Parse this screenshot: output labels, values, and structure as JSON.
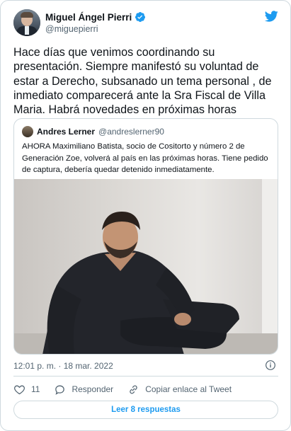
{
  "author": {
    "name": "Miguel Ángel Pierri",
    "handle": "@miguepierri",
    "verified": true
  },
  "tweet": {
    "text": "Hace días que venimos coordinando su presentación. Siempre manifestó su voluntad de estar a Derecho, subsanado un tema personal , de inmediato comparecerá ante la Sra Fiscal de Villa Maria. Habrá novedades en próximas horas"
  },
  "quoted": {
    "name": "Andres Lerner",
    "handle": "@andreslerner90",
    "text": "AHORA Maximiliano Batista, socio de Cositorto y número 2 de Generación Zoe, volverá al país en las próximas horas. Tiene pedido de captura, debería quedar detenido inmediatamente."
  },
  "meta": {
    "timestamp": "12:01 p. m. · 18 mar. 2022"
  },
  "actions": {
    "like_count": "11",
    "reply_label": "Responder",
    "copy_link_label": "Copiar enlace al Tweet"
  },
  "more_replies_label": "Leer 8 respuestas",
  "colors": {
    "accent": "#1d9bf0",
    "text": "#0f1419",
    "secondary": "#536471",
    "border": "#cfd9de"
  },
  "icons": [
    "verified-badge-icon",
    "twitter-bird-icon",
    "info-icon",
    "heart-icon",
    "reply-icon",
    "link-icon"
  ]
}
